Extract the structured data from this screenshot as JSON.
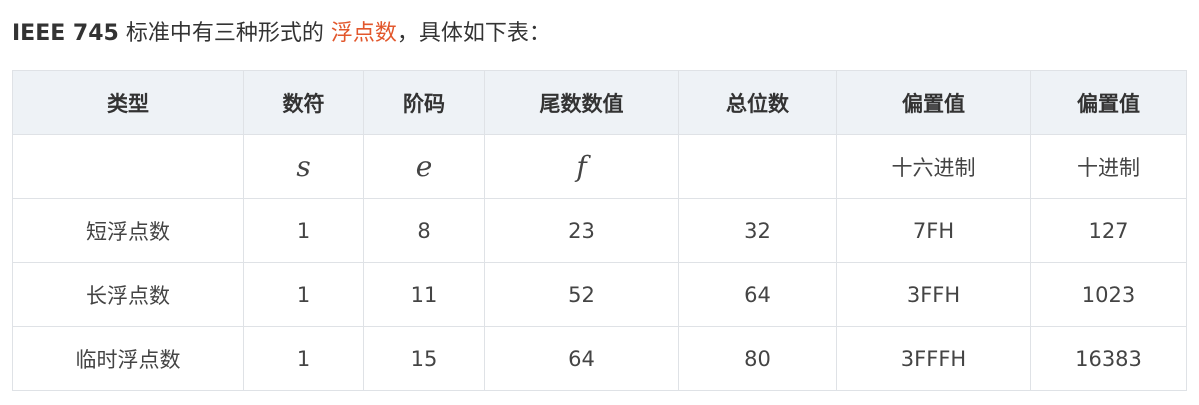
{
  "intro": {
    "prefix": "IEEE 745",
    "middle": " 标准中有三种形式的 ",
    "link": "浮点数",
    "suffix": "，具体如下表："
  },
  "table": {
    "headers": [
      "类型",
      "数符",
      "阶码",
      "尾数数值",
      "总位数",
      "偏置值",
      "偏置值"
    ],
    "symbol_row": [
      "",
      "s",
      "e",
      "f",
      "",
      "十六进制",
      "十进制"
    ],
    "rows": [
      [
        "短浮点数",
        "1",
        "8",
        "23",
        "32",
        "7FH",
        "127"
      ],
      [
        "长浮点数",
        "1",
        "11",
        "52",
        "64",
        "3FFH",
        "1023"
      ],
      [
        "临时浮点数",
        "1",
        "15",
        "64",
        "80",
        "3FFFH",
        "16383"
      ]
    ]
  },
  "colors": {
    "link": "#e2572c",
    "header_bg": "#eef2f6",
    "border": "#dfe2e6"
  }
}
